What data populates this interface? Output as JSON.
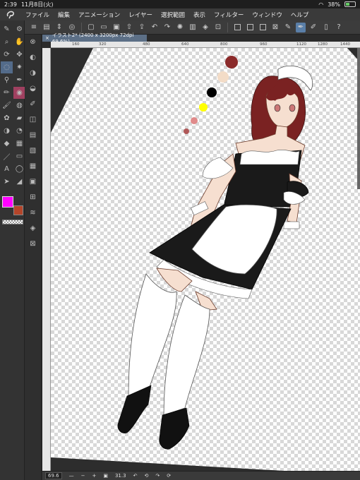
{
  "status": {
    "time": "2:39",
    "date": "11月8日(火)",
    "battery": "38%"
  },
  "menu": {
    "items": [
      "ファイル",
      "編集",
      "アニメーション",
      "レイヤー",
      "選択範囲",
      "表示",
      "フィルター",
      "ウィンドウ",
      "ヘルプ"
    ]
  },
  "document": {
    "tab_label": "イラスト2* (2400 x 3200px 72dpi 69.6%)"
  },
  "ruler": {
    "top_ticks": [
      "160",
      "320",
      "480",
      "640",
      "800",
      "960",
      "1120",
      "1280",
      "1440"
    ]
  },
  "bottom": {
    "zoom": "69.6",
    "rotation": "31.3"
  },
  "colors": {
    "main_color": "#ff00ff",
    "sub_color": "#b5452a",
    "palette": [
      "#8b2a2a",
      "#f3dcc7",
      "#000000",
      "#ffff00",
      "#e08a8a",
      "#b05858"
    ]
  }
}
